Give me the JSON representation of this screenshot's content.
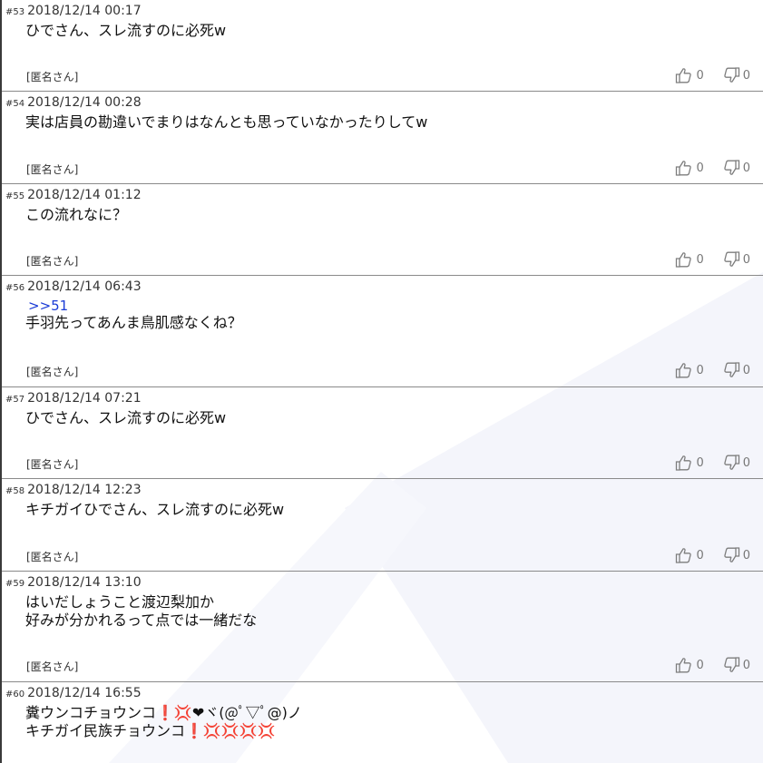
{
  "thread": {
    "posts": [
      {
        "num": "#53",
        "date": "2018/12/14 00:17",
        "lines": [
          "ひでさん、スレ流すのに必死w"
        ],
        "name": "[匿名さん]",
        "likes": "0",
        "dislikes": "0"
      },
      {
        "num": "#54",
        "date": "2018/12/14 00:28",
        "lines": [
          "実は店員の勘違いでまりはなんとも思っていなかったりしてw"
        ],
        "name": "[匿名さん]",
        "likes": "0",
        "dislikes": "0"
      },
      {
        "num": "#55",
        "date": "2018/12/14 01:12",
        "lines": [
          "この流れなに？"
        ],
        "name": "[匿名さん]",
        "likes": "0",
        "dislikes": "0"
      },
      {
        "num": "#56",
        "date": "2018/12/14 06:43",
        "anchor": ">>51",
        "lines": [
          "手羽先ってあんま鳥肌感なくね？"
        ],
        "name": "[匿名さん]",
        "likes": "0",
        "dislikes": "0"
      },
      {
        "num": "#57",
        "date": "2018/12/14 07:21",
        "lines": [
          "ひでさん、スレ流すのに必死w"
        ],
        "name": "[匿名さん]",
        "likes": "0",
        "dislikes": "0"
      },
      {
        "num": "#58",
        "date": "2018/12/14 12:23",
        "lines": [
          "キチガイひでさん、スレ流すのに必死w"
        ],
        "name": "[匿名さん]",
        "likes": "0",
        "dislikes": "0"
      },
      {
        "num": "#59",
        "date": "2018/12/14 13:10",
        "lines": [
          "はいだしょうこと渡辺梨加か",
          "好みが分かれるって点では一緒だな"
        ],
        "name": "[匿名さん]",
        "likes": "0",
        "dislikes": "0"
      },
      {
        "num": "#60",
        "date": "2018/12/14 16:55",
        "lines": [
          "糞ウンコチョウンコ❗💢❤ヾ(@ﾟ▽ﾟ@)ノ",
          "キチガイ民族チョウンコ❗💢💢💢💢"
        ],
        "name": "",
        "likes": "",
        "dislikes": ""
      }
    ]
  },
  "colors": {
    "anchor": "#1a3bd6",
    "divider": "#8a8a8a",
    "emphasis": "#e02020"
  },
  "icons": {
    "like": "thumbs-up-icon",
    "dislike": "thumbs-down-icon"
  }
}
